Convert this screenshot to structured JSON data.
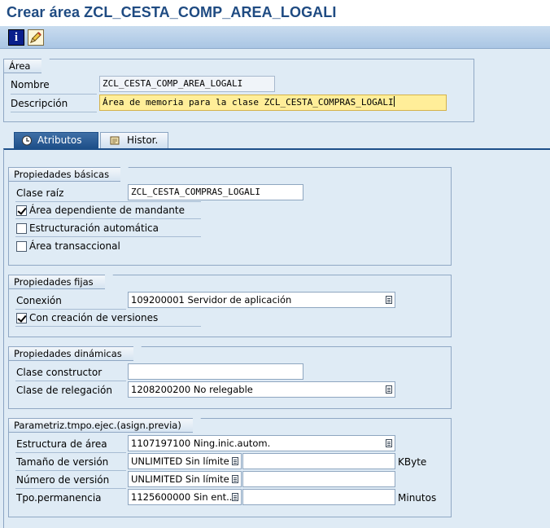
{
  "window": {
    "title": "Crear área ZCL_CESTA_COMP_AREA_LOGALI"
  },
  "toolbar": {
    "info_icon": "info-icon",
    "edit_icon": "pencil-icon"
  },
  "area": {
    "group_title": "Área",
    "nombre_label": "Nombre",
    "nombre_value": "ZCL_CESTA_COMP_AREA_LOGALI",
    "descripcion_label": "Descripción",
    "descripcion_value": "Área de memoria para la clase ZCL_CESTA_COMPRAS_LOGALI"
  },
  "tabs": [
    {
      "label": "Atributos",
      "icon": "clock-icon",
      "active": true
    },
    {
      "label": "Histor.",
      "icon": "scroll-icon",
      "active": false
    }
  ],
  "basicas": {
    "group_title": "Propiedades básicas",
    "clase_raiz_label": "Clase raíz",
    "clase_raiz_value": "ZCL_CESTA_COMPRAS_LOGALI",
    "dependiente_label": "Área dependiente de mandante",
    "dependiente_checked": true,
    "estructuracion_label": "Estructuración automática",
    "estructuracion_checked": false,
    "transaccional_label": "Área transaccional",
    "transaccional_checked": false
  },
  "fijas": {
    "group_title": "Propiedades fijas",
    "conexion_label": "Conexión",
    "conexion_value": "109200001 Servidor de aplicación",
    "versiones_label": "Con creación de versiones",
    "versiones_checked": true
  },
  "dinamicas": {
    "group_title": "Propiedades dinámicas",
    "constructor_label": "Clase constructor",
    "constructor_value": "",
    "relegacion_label": "Clase de relegación",
    "relegacion_value": "1208200200 No relegable"
  },
  "parametriz": {
    "group_title": "Parametriz.tmpo.ejec.(asign.previa)",
    "estructura_label": "Estructura de área",
    "estructura_value": "1107197100 Ning.inic.autom.",
    "tamano_label": "Tamaño de versión",
    "tamano_value": "UNLIMITED Sin límite",
    "tamano_unit": "KByte",
    "numero_label": "Número de versión",
    "numero_value": "UNLIMITED Sin límite",
    "permanencia_label": "Tpo.permanencia",
    "permanencia_value": "1125600000 Sin ent...",
    "permanencia_unit": "Minutos"
  }
}
